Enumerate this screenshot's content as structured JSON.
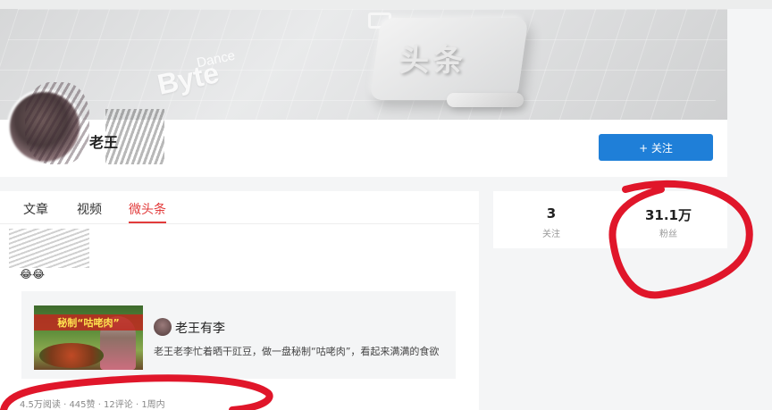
{
  "banner": {
    "brand_byte": "Byte",
    "brand_dance": "Dance",
    "logo_text": "头条"
  },
  "profile": {
    "name": "老王",
    "follow_button": "+ 关注"
  },
  "tabs": [
    {
      "label": "文章"
    },
    {
      "label": "视频"
    },
    {
      "label": "微头条"
    }
  ],
  "post": {
    "emoji": "😂😂",
    "card": {
      "thumb_banner": "秘制“咕咾肉”",
      "author": "老王有李",
      "description": "老王老李忙着晒干豇豆，做一盘秘制“咕咾肉”，看起来满满的食欲"
    },
    "stats": "4.5万阅读 · 445赞 · 12评论 · 1周内"
  },
  "side_stats": {
    "following_count": "3",
    "following_label": "关注",
    "fans_count": "31.1万",
    "fans_label": "粉丝"
  },
  "colors": {
    "accent_blue": "#1f7fd8",
    "tab_active": "#e23b3b",
    "annotation_red": "#e0162a"
  }
}
